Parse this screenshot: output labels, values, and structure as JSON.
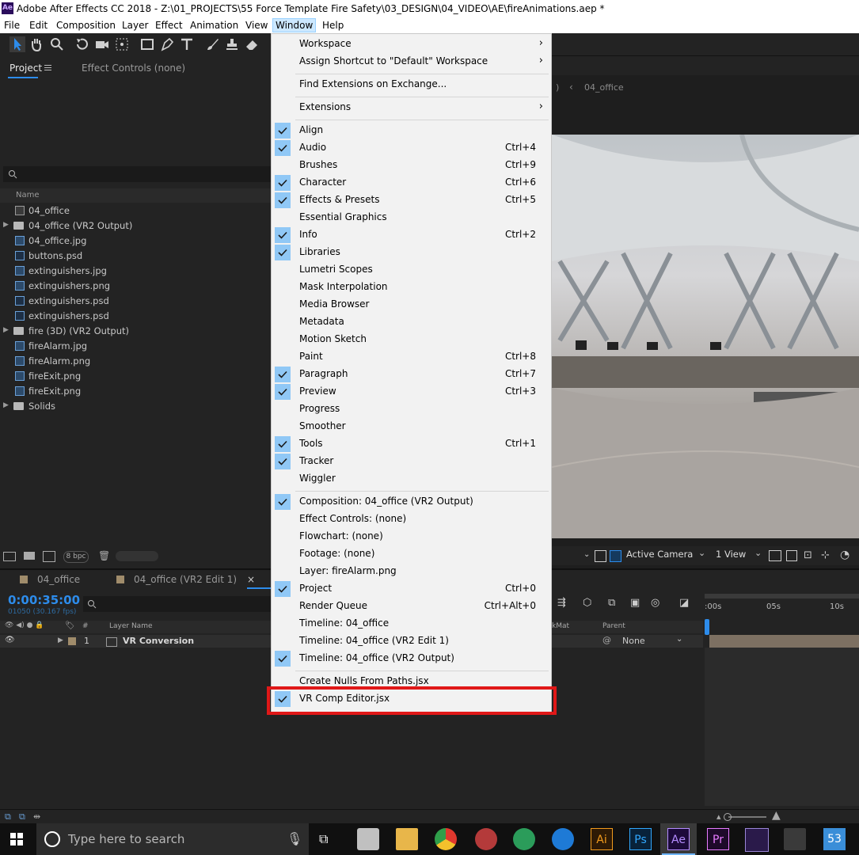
{
  "title_bar": {
    "app_icon": "Ae",
    "title": "Adobe After Effects CC 2018 - Z:\\01_PROJECTS\\55 Force Template Fire Safety\\03_DESIGN\\04_VIDEO\\AE\\fireAnimations.aep *"
  },
  "menubar": [
    "File",
    "Edit",
    "Composition",
    "Layer",
    "Effect",
    "Animation",
    "View",
    "Window",
    "Help"
  ],
  "project_panel": {
    "tab_project": "Project",
    "tab_effect_controls": "Effect Controls (none)",
    "search_icon": "search-icon",
    "column_name": "Name",
    "items": [
      {
        "label": "04_office",
        "icon": "comp"
      },
      {
        "label": "04_office (VR2 Output)",
        "icon": "folder"
      },
      {
        "label": "04_office.jpg",
        "icon": "img"
      },
      {
        "label": "buttons.psd",
        "icon": "psd"
      },
      {
        "label": "extinguishers.jpg",
        "icon": "img"
      },
      {
        "label": "extinguishers.png",
        "icon": "img"
      },
      {
        "label": "extinguishers.psd",
        "icon": "psd"
      },
      {
        "label": "extinguishers.psd",
        "icon": "psd"
      },
      {
        "label": "fire (3D) (VR2 Output)",
        "icon": "folder"
      },
      {
        "label": "fireAlarm.jpg",
        "icon": "img"
      },
      {
        "label": "fireAlarm.png",
        "icon": "img"
      },
      {
        "label": "fireExit.png",
        "icon": "img"
      },
      {
        "label": "fireExit.png",
        "icon": "img"
      },
      {
        "label": "Solids",
        "icon": "folder"
      }
    ],
    "bpc": "8 bpc"
  },
  "viewer": {
    "breadcrumb_partial": ")",
    "breadcrumb_chevron": "‹",
    "breadcrumb": "04_office",
    "active_camera": "Active Camera",
    "views": "1 View"
  },
  "timeline": {
    "tabs": [
      "04_office",
      "04_office (VR2 Edit 1)"
    ],
    "timecode": "0:00:35:00",
    "frames": "01050 (30.167 fps)",
    "col_layer_name": "Layer Name",
    "col_hash": "#",
    "col_trkmat": "kMat",
    "col_parent": "Parent",
    "layer_number": "1",
    "layer_name": "VR Conversion",
    "parent_value": "None",
    "ruler": [
      ":00s",
      "05s",
      "10s"
    ]
  },
  "window_menu": {
    "items": [
      {
        "label": "Workspace",
        "submenu": true
      },
      {
        "label": "Assign Shortcut to \"Default\" Workspace",
        "submenu": true
      },
      {
        "label": "Find Extensions on Exchange..."
      },
      {
        "label": "Extensions",
        "submenu": true
      },
      {
        "label": "Align",
        "checked": true
      },
      {
        "label": "Audio",
        "checked": true,
        "shortcut": "Ctrl+4"
      },
      {
        "label": "Brushes",
        "shortcut": "Ctrl+9"
      },
      {
        "label": "Character",
        "checked": true,
        "shortcut": "Ctrl+6"
      },
      {
        "label": "Effects & Presets",
        "checked": true,
        "shortcut": "Ctrl+5"
      },
      {
        "label": "Essential Graphics"
      },
      {
        "label": "Info",
        "checked": true,
        "shortcut": "Ctrl+2"
      },
      {
        "label": "Libraries",
        "checked": true
      },
      {
        "label": "Lumetri Scopes"
      },
      {
        "label": "Mask Interpolation"
      },
      {
        "label": "Media Browser"
      },
      {
        "label": "Metadata"
      },
      {
        "label": "Motion Sketch"
      },
      {
        "label": "Paint",
        "shortcut": "Ctrl+8"
      },
      {
        "label": "Paragraph",
        "checked": true,
        "shortcut": "Ctrl+7"
      },
      {
        "label": "Preview",
        "checked": true,
        "shortcut": "Ctrl+3"
      },
      {
        "label": "Progress"
      },
      {
        "label": "Smoother"
      },
      {
        "label": "Tools",
        "checked": true,
        "shortcut": "Ctrl+1"
      },
      {
        "label": "Tracker",
        "checked": true
      },
      {
        "label": "Wiggler"
      },
      {
        "label": "Composition: 04_office (VR2 Output)",
        "checked": true
      },
      {
        "label": "Effect Controls: (none)"
      },
      {
        "label": "Flowchart: (none)"
      },
      {
        "label": "Footage: (none)"
      },
      {
        "label": "Layer: fireAlarm.png"
      },
      {
        "label": "Project",
        "checked": true,
        "shortcut": "Ctrl+0"
      },
      {
        "label": "Render Queue",
        "shortcut": "Ctrl+Alt+0"
      },
      {
        "label": "Timeline: 04_office"
      },
      {
        "label": "Timeline: 04_office (VR2 Edit 1)"
      },
      {
        "label": "Timeline: 04_office (VR2 Output)",
        "checked": true
      },
      {
        "label": "Create Nulls From Paths.jsx"
      },
      {
        "label": "VR Comp Editor.jsx",
        "checked": true
      }
    ]
  },
  "taskbar": {
    "search_placeholder": "Type here to search",
    "apps": [
      "Ai",
      "Ps",
      "Ae",
      "Pr",
      "53"
    ]
  },
  "colors": {
    "check_bg": "#90c8f6",
    "highlight": "#e01818",
    "accent": "#2d8ceb"
  }
}
